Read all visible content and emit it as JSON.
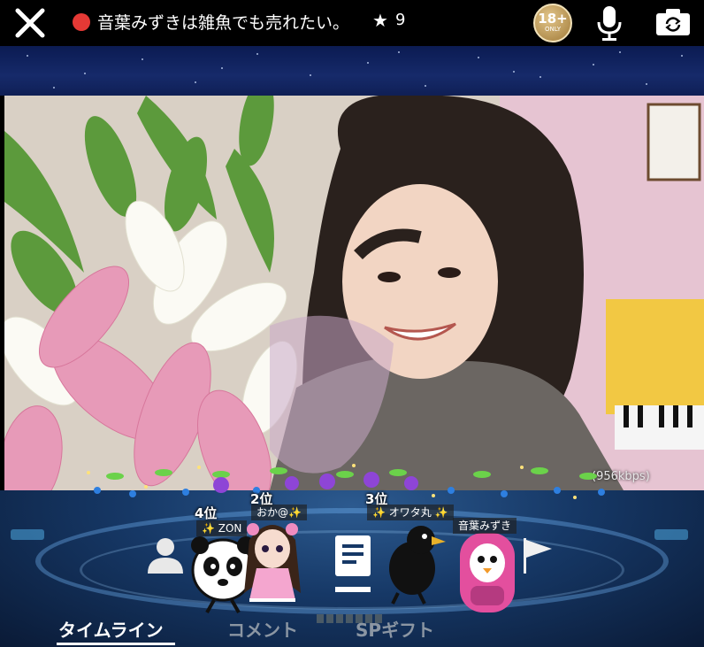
{
  "topbar": {
    "title": "音葉みずきは雑魚でも売れたい。",
    "star_count": "9",
    "age_badge": {
      "number": "18+",
      "sub": "ONLY"
    },
    "icons": {
      "close": "close-icon",
      "live": "live-dot-icon",
      "star": "star-icon",
      "mic": "microphone-icon",
      "camera": "camera-switch-icon"
    }
  },
  "video": {
    "bitrate": "(956kbps)"
  },
  "ranking": [
    {
      "rank": "4位",
      "name": "✨ ZON"
    },
    {
      "rank": "2位",
      "name": "おか@✨"
    },
    {
      "rank": "3位",
      "name": "✨ オワタ丸 ✨"
    },
    {
      "rank": "",
      "name": "音葉みずき"
    }
  ],
  "tabs": [
    {
      "label": "タイムライン",
      "active": true
    },
    {
      "label": "コメント",
      "active": false
    },
    {
      "label": "SPギフト",
      "active": false
    }
  ],
  "colors": {
    "live": "#e53935",
    "stage": "#163866",
    "accent": "#4fa9e0"
  }
}
